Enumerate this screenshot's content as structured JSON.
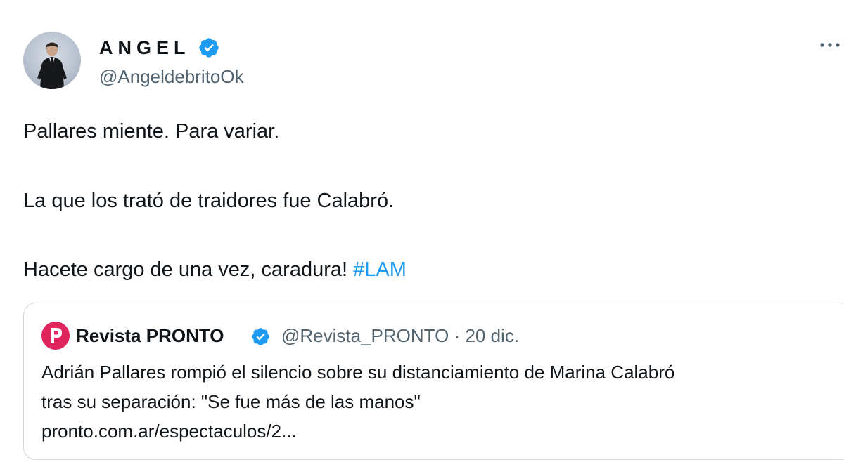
{
  "tweet": {
    "author": {
      "name": "ANGEL",
      "handle": "@AngeldebritoOk",
      "verified": true
    },
    "text": {
      "line1": "Pallares miente. Para variar.",
      "line2": "La que los trató de traidores fue Calabró.",
      "line3": "Hacete cargo de una vez, caradura! ",
      "hashtag": "#LAM"
    },
    "quote": {
      "name": "Revista PRONTO",
      "handle": "@Revista_PRONTO",
      "separator": "·",
      "date": "20 dic.",
      "text_line1": "Adrián Pallares rompió el silencio sobre su distanciamiento de Marina Calabró",
      "text_line2": "tras su separación: \"Se fue más de las manos\"",
      "link": "pronto.com.ar/espectaculos/2..."
    }
  },
  "colors": {
    "text_primary": "#0f1419",
    "text_secondary": "#536471",
    "accent": "#1d9bf0",
    "border": "#cfd9de",
    "pronto_brand": "#e0245e"
  },
  "icons": {
    "verified": "verified-badge-icon",
    "more": "more-options-icon",
    "pronto_logo": "pronto-logo-icon"
  }
}
